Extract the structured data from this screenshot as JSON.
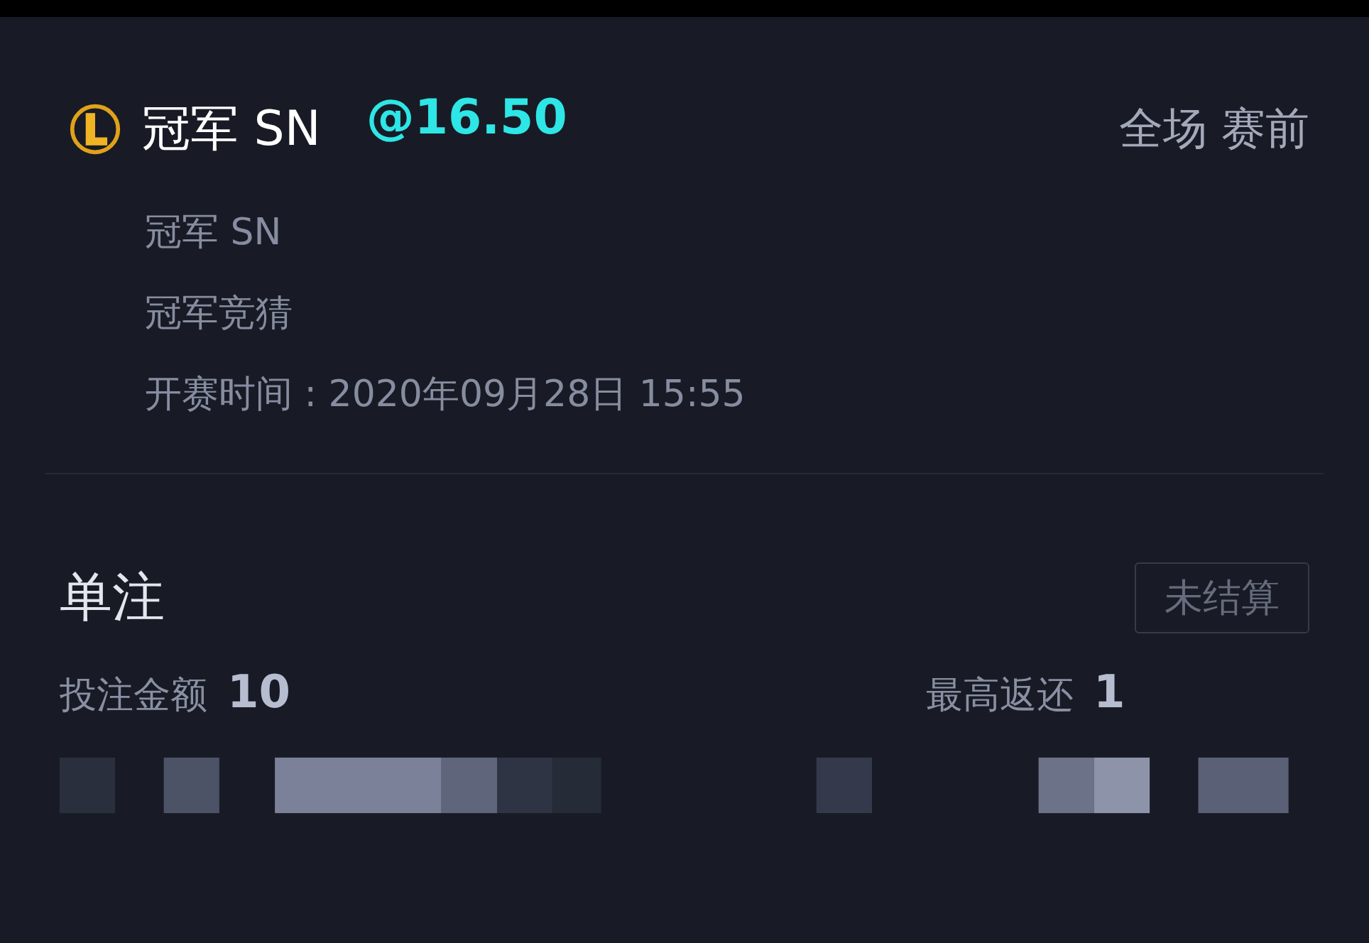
{
  "bet": {
    "title": "冠军 SN",
    "odds": "@16.50",
    "market_tag": "全场 赛前",
    "details": [
      "冠军 SN",
      "冠军竞猜",
      "开赛时间 : 2020年09月28日  15:55"
    ]
  },
  "summary": {
    "type": "单注",
    "status": "未结算",
    "stake_label": "投注金额",
    "stake_value": "10",
    "return_label": "最高返还",
    "return_value": "1"
  }
}
